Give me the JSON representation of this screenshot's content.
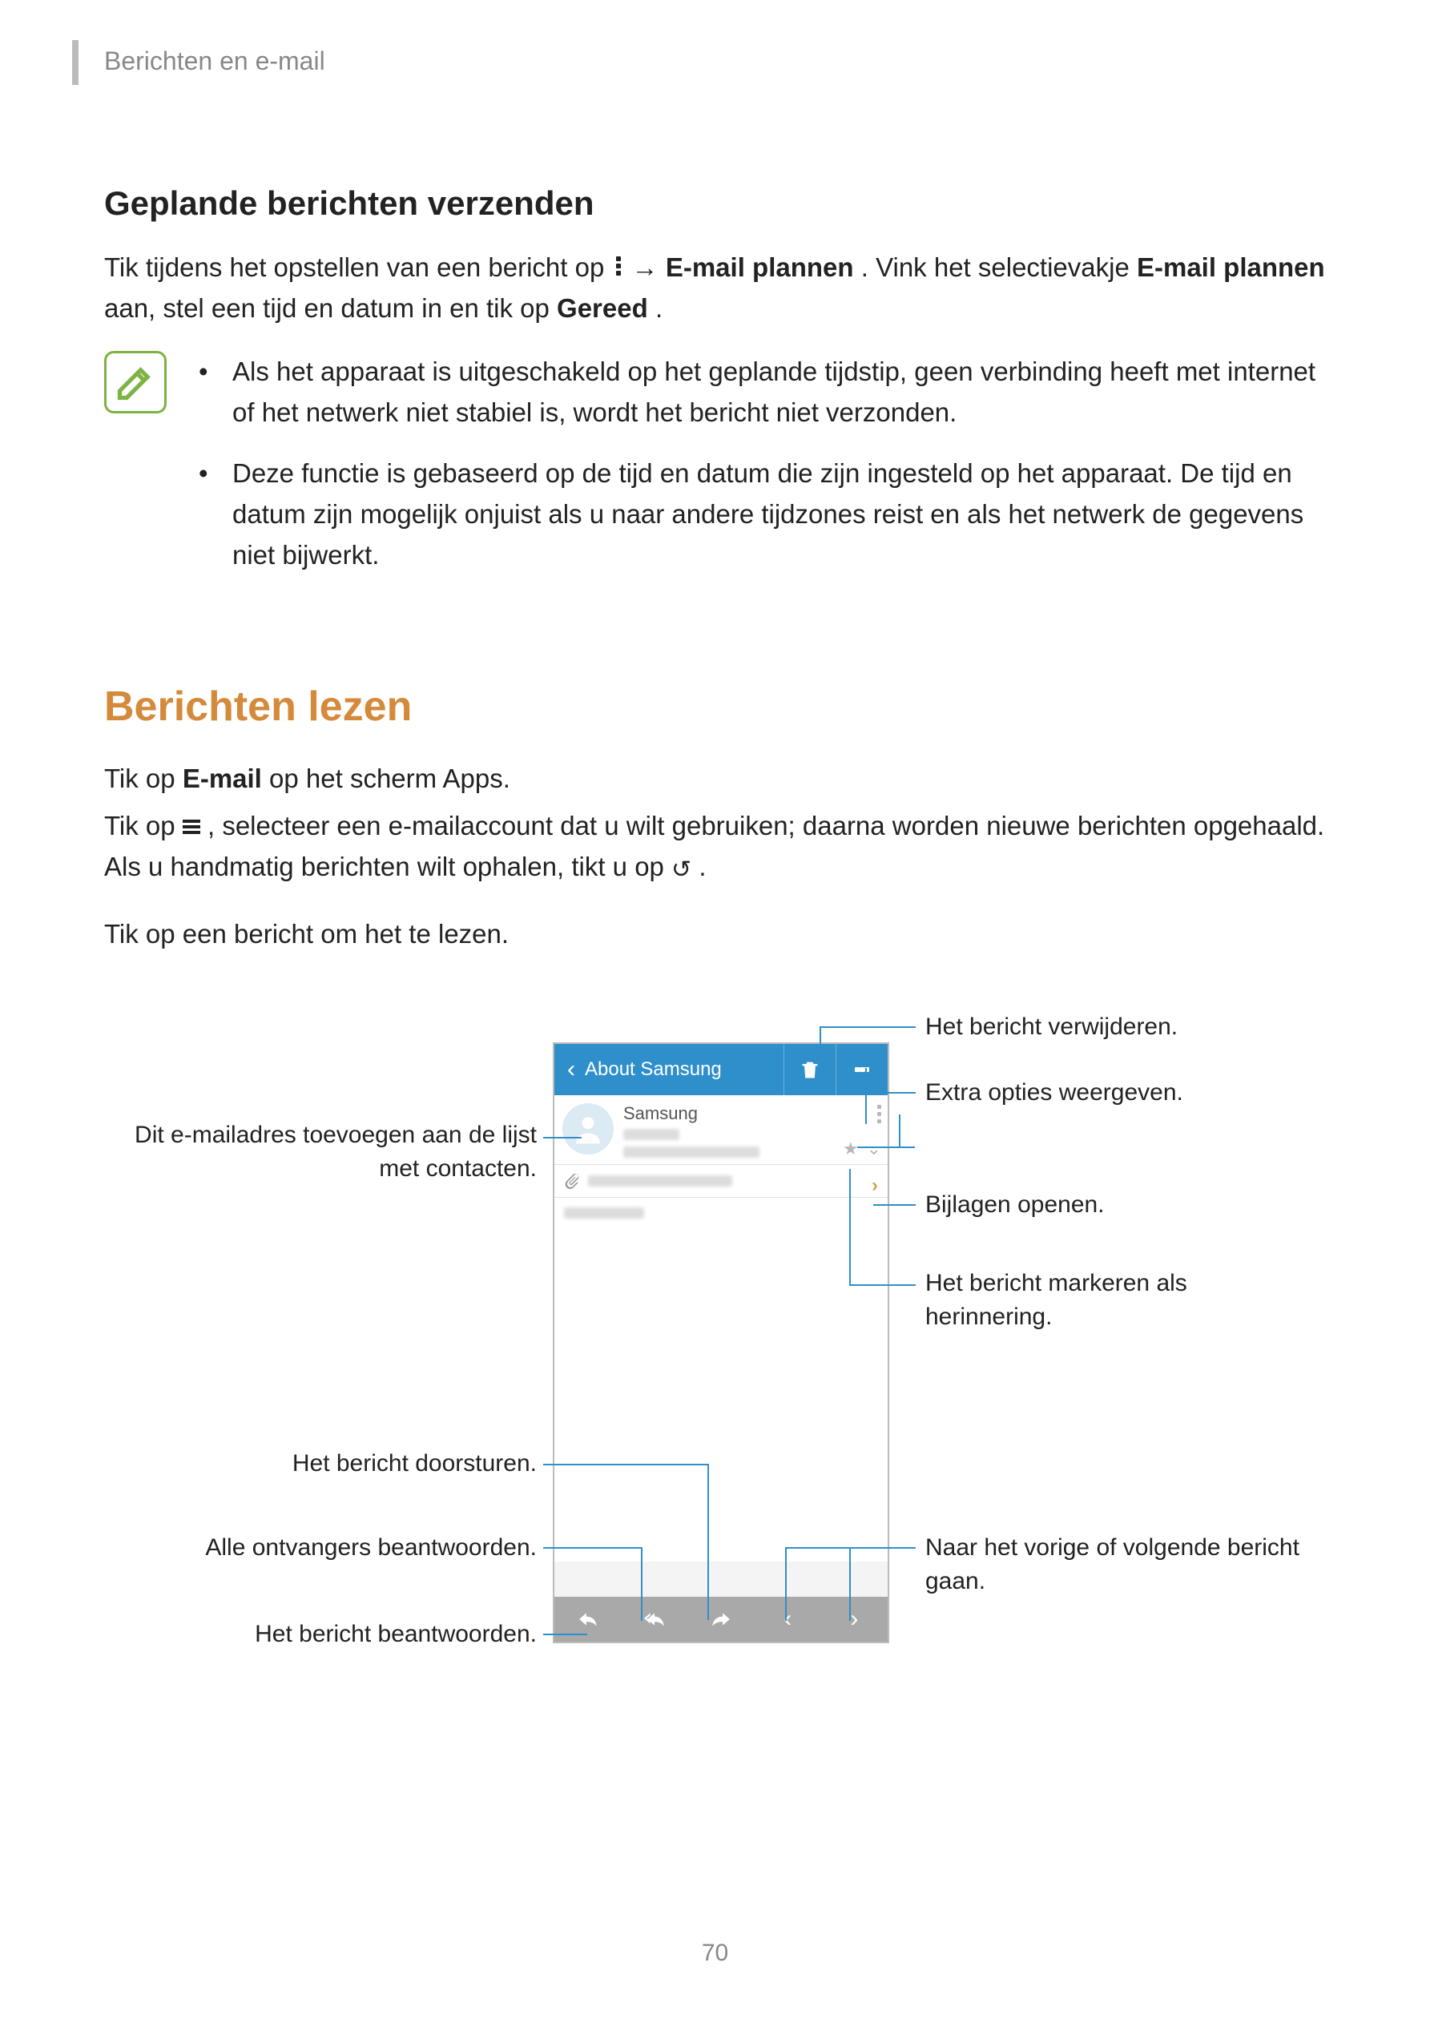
{
  "header": {
    "section": "Berichten en e-mail"
  },
  "section1": {
    "title": "Geplande berichten verzenden",
    "para_parts": {
      "a": "Tik tijdens het opstellen van een bericht op ",
      "arrow": " → ",
      "b": "E-mail plannen",
      "c": ". Vink het selectievakje ",
      "d": "E-mail plannen",
      "e": " aan, stel een tijd en datum in en tik op ",
      "f": "Gereed",
      "g": "."
    },
    "notes": [
      "Als het apparaat is uitgeschakeld op het geplande tijdstip, geen verbinding heeft met internet of het netwerk niet stabiel is, wordt het bericht niet verzonden.",
      "Deze functie is gebaseerd op de tijd en datum die zijn ingesteld op het apparaat. De tijd en datum zijn mogelijk onjuist als u naar andere tijdzones reist en als het netwerk de gegevens niet bijwerkt."
    ]
  },
  "section2": {
    "title": "Berichten lezen",
    "p1": {
      "a": "Tik op ",
      "b": "E-mail",
      "c": " op het scherm Apps."
    },
    "p2": {
      "a": "Tik op ",
      "b": ", selecteer een e-mailaccount dat u wilt gebruiken; daarna worden nieuwe berichten opgehaald. Als u handmatig berichten wilt ophalen, tikt u op ",
      "c": "."
    },
    "p3": "Tik op een bericht om het te lezen."
  },
  "figure": {
    "titlebar": "About Samsung",
    "sender": "Samsung"
  },
  "callouts": {
    "delete": "Het bericht verwijderen.",
    "extra": "Extra opties weergeven.",
    "addcontact": "Dit e-mailadres toevoegen aan de lijst met contacten.",
    "openattach": "Bijlagen openen.",
    "reminder": "Het bericht markeren als herinnering.",
    "forward": "Het bericht doorsturen.",
    "replyall": "Alle ontvangers beantwoorden.",
    "reply": "Het bericht beantwoorden.",
    "prevnext": "Naar het vorige of volgende bericht gaan."
  },
  "page_number": "70"
}
